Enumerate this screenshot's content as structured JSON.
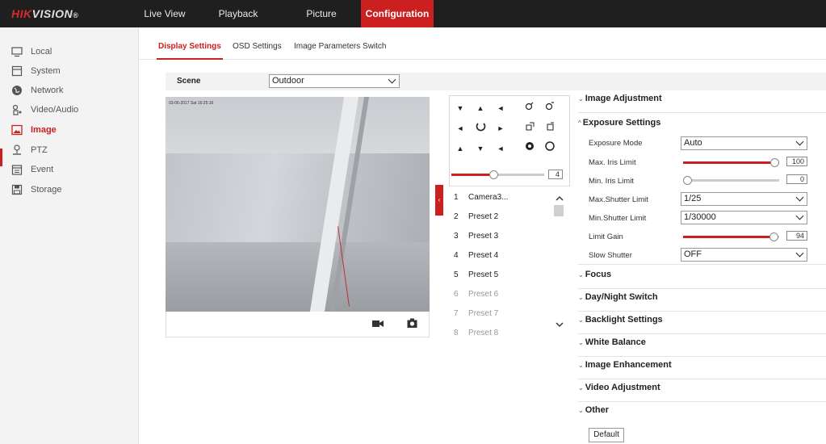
{
  "brand": {
    "name_red": "HIK",
    "name_white": "VISION",
    "mark": "®"
  },
  "nav": [
    {
      "label": "Live View"
    },
    {
      "label": "Playback"
    },
    {
      "label": "Picture"
    },
    {
      "label": "Configuration"
    }
  ],
  "sidebar": {
    "items": [
      {
        "label": "Local",
        "icon": "monitor-icon"
      },
      {
        "label": "System",
        "icon": "system-icon"
      },
      {
        "label": "Network",
        "icon": "globe-icon"
      },
      {
        "label": "Video/Audio",
        "icon": "video-audio-icon"
      },
      {
        "label": "Image",
        "icon": "image-icon"
      },
      {
        "label": "PTZ",
        "icon": "ptz-icon"
      },
      {
        "label": "Event",
        "icon": "calendar-icon"
      },
      {
        "label": "Storage",
        "icon": "storage-icon"
      }
    ],
    "active": "Image"
  },
  "tabs": [
    {
      "label": "Display Settings"
    },
    {
      "label": "OSD Settings"
    },
    {
      "label": "Image Parameters Switch"
    }
  ],
  "scene": {
    "label": "Scene",
    "value": "Outdoor"
  },
  "video": {
    "osd_text": "03-06-2017 Sat 16:25:16"
  },
  "ptz": {
    "speed": {
      "value": "4",
      "fraction": 0.45
    },
    "presets": [
      {
        "num": "1",
        "name": "Camera3..."
      },
      {
        "num": "2",
        "name": "Preset 2"
      },
      {
        "num": "3",
        "name": "Preset 3"
      },
      {
        "num": "4",
        "name": "Preset 4"
      },
      {
        "num": "5",
        "name": "Preset 5"
      },
      {
        "num": "6",
        "name": "Preset 6"
      },
      {
        "num": "7",
        "name": "Preset 7"
      },
      {
        "num": "8",
        "name": "Preset 8"
      }
    ]
  },
  "sections": {
    "image_adjustment": "Image Adjustment",
    "exposure_settings": "Exposure Settings",
    "focus": "Focus",
    "day_night": "Day/Night Switch",
    "backlight": "Backlight Settings",
    "white_balance": "White Balance",
    "image_enhancement": "Image Enhancement",
    "video_adjustment": "Video Adjustment",
    "other": "Other"
  },
  "exposure": {
    "mode": {
      "label": "Exposure Mode",
      "value": "Auto"
    },
    "max_iris": {
      "label": "Max. Iris Limit",
      "value": "100",
      "fraction": 1.0
    },
    "min_iris": {
      "label": "Min. Iris Limit",
      "value": "0",
      "fraction": 0.0
    },
    "max_shutter": {
      "label": "Max.Shutter Limit",
      "value": "1/25"
    },
    "min_shutter": {
      "label": "Min.Shutter Limit",
      "value": "1/30000"
    },
    "limit_gain": {
      "label": "Limit Gain",
      "value": "94",
      "fraction": 0.94
    },
    "slow_shutter": {
      "label": "Slow Shutter",
      "value": "OFF"
    }
  },
  "default_label": "Default",
  "colors": {
    "accent": "#cc1f1f",
    "topbar": "#1f1f1f",
    "sidebar": "#f3f3f3"
  }
}
